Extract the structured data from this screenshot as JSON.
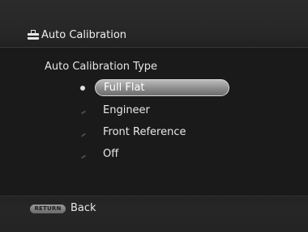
{
  "header": {
    "title": "Auto Calibration",
    "icon": "toolbox-icon"
  },
  "section": {
    "heading": "Auto Calibration Type"
  },
  "options": [
    {
      "label": "Full Flat",
      "selected": true
    },
    {
      "label": "Engineer",
      "selected": false
    },
    {
      "label": "Front Reference",
      "selected": false
    },
    {
      "label": "Off",
      "selected": false
    }
  ],
  "footer": {
    "return_button": "RETURN",
    "back_label": "Back"
  },
  "colors": {
    "background": "#1a1a1a",
    "bar": "#262626",
    "highlight": "#9a9a9a",
    "text": "#e8e8e8"
  }
}
